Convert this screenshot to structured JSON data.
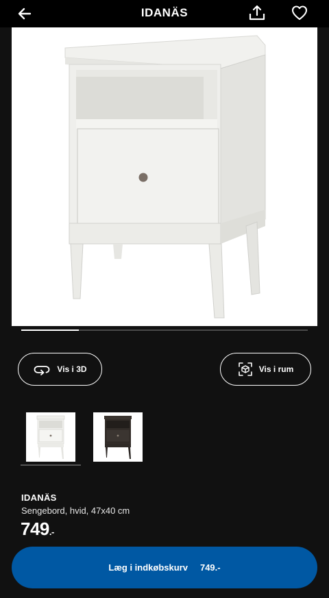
{
  "header": {
    "title": "IDANÄS",
    "back_icon": "arrow-left-icon",
    "share_icon": "share-icon",
    "favorite_icon": "heart-icon"
  },
  "gallery": {
    "progress": 0.2,
    "thumbnails": [
      {
        "name": "white",
        "selected": true
      },
      {
        "name": "dark-brown",
        "selected": false
      }
    ]
  },
  "actions": {
    "view_3d": "Vis i 3D",
    "view_room": "Vis i rum"
  },
  "product": {
    "name": "IDANÄS",
    "description": "Sengebord, hvid, 47x40 cm",
    "price": "749",
    "price_suffix": ".-"
  },
  "cart": {
    "label": "Læg i indkøbskurv",
    "price": "749.-",
    "color": "#0058a3"
  }
}
